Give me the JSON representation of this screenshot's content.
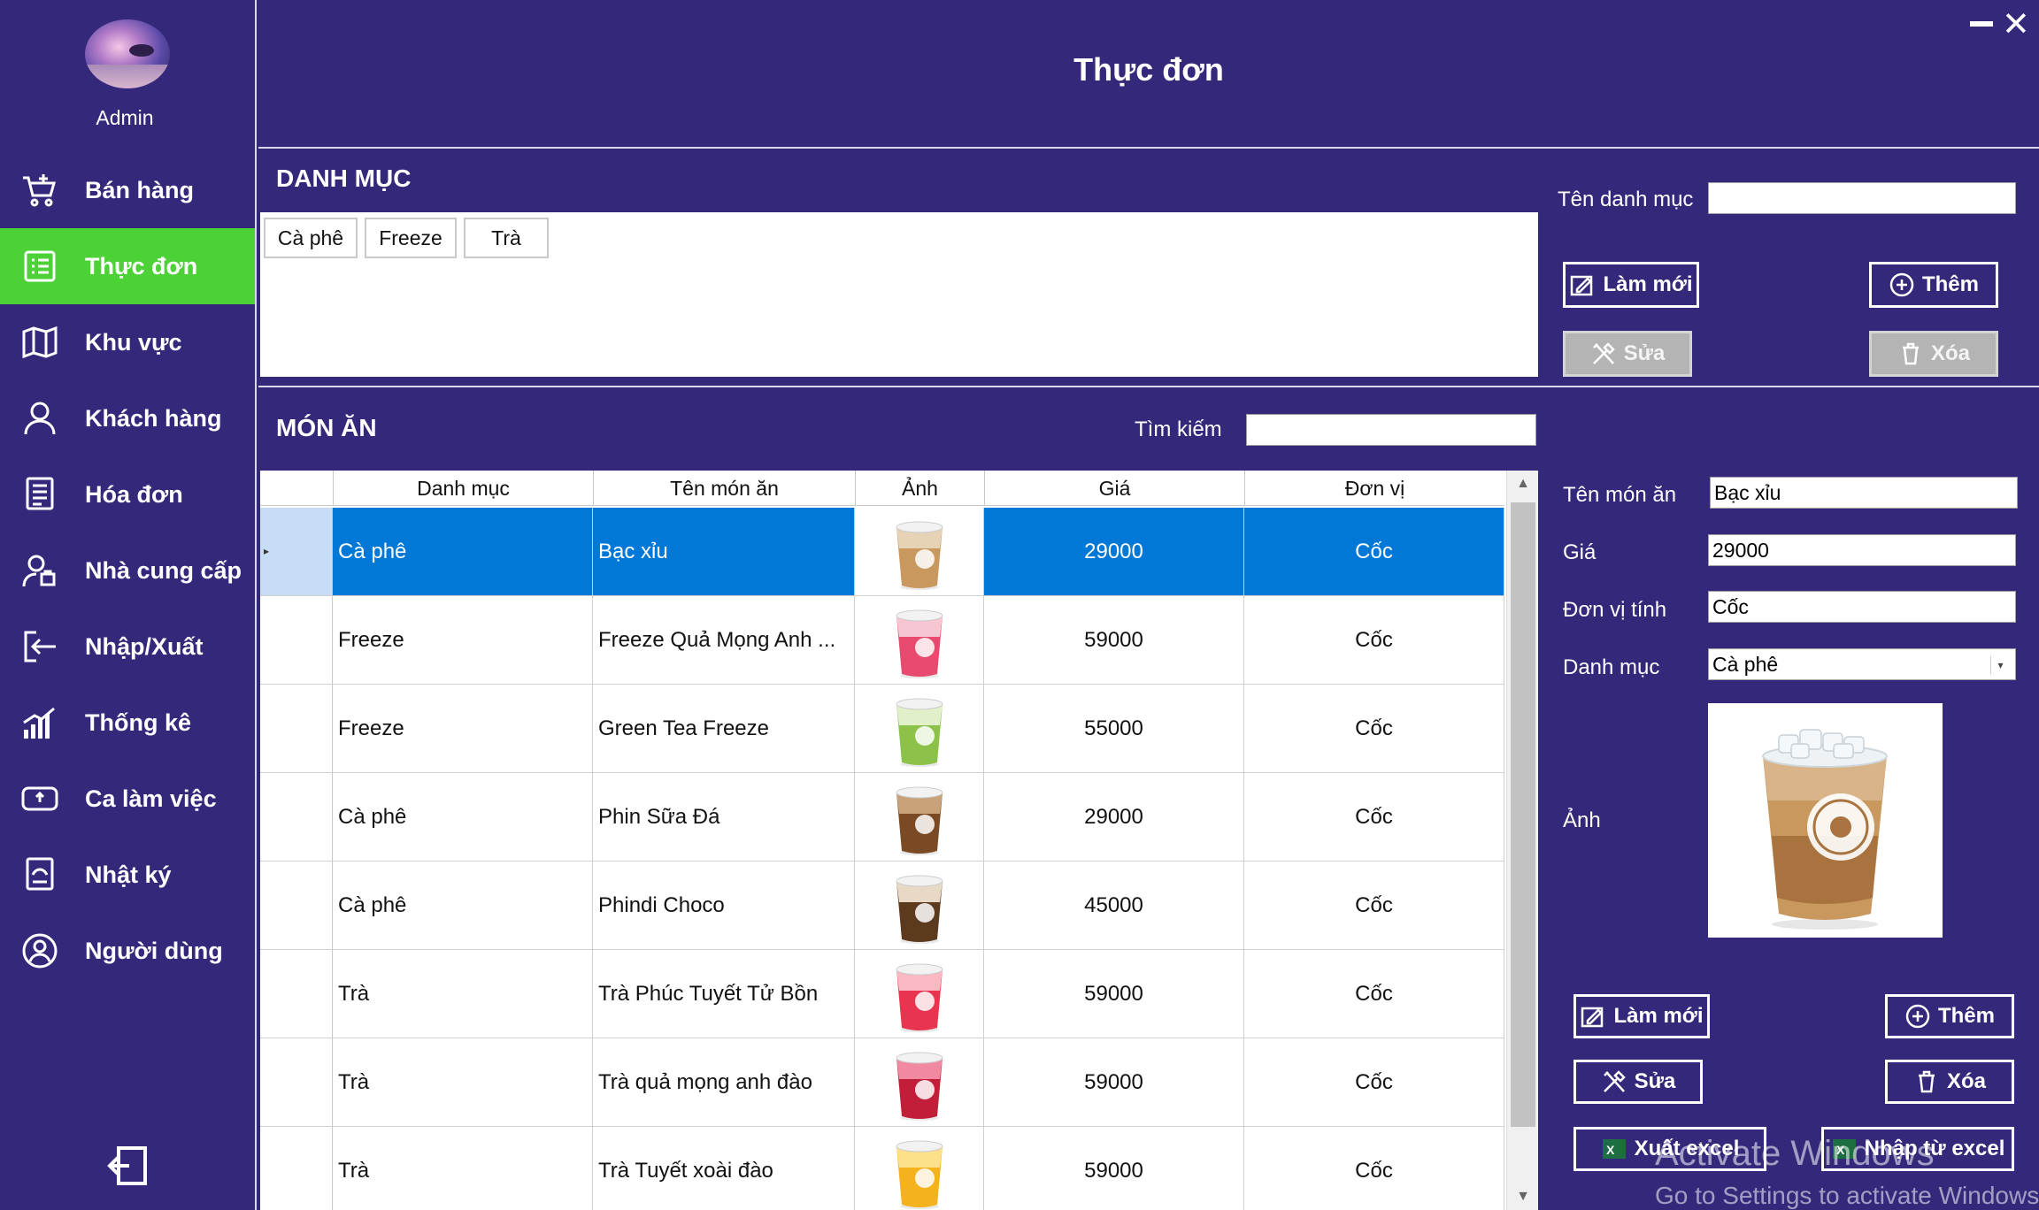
{
  "user": {
    "name": "Admin"
  },
  "window": {
    "title": "Thực đơn"
  },
  "sidebar": {
    "items": [
      {
        "label": "Bán hàng",
        "icon": "cart-icon"
      },
      {
        "label": "Thực đơn",
        "icon": "menu-list-icon",
        "active": true
      },
      {
        "label": "Khu vực",
        "icon": "map-icon"
      },
      {
        "label": "Khách hàng",
        "icon": "person-icon"
      },
      {
        "label": "Hóa đơn",
        "icon": "invoice-icon"
      },
      {
        "label": "Nhà cung cấp",
        "icon": "supplier-icon"
      },
      {
        "label": "Nhập/Xuất",
        "icon": "import-export-icon"
      },
      {
        "label": "Thống kê",
        "icon": "chart-icon"
      },
      {
        "label": "Ca làm việc",
        "icon": "shift-icon"
      },
      {
        "label": "Nhật ký",
        "icon": "log-icon"
      },
      {
        "label": "Người dùng",
        "icon": "user-circle-icon"
      }
    ]
  },
  "category": {
    "section_title": "DANH MỤC",
    "chips": [
      "Cà phê",
      "Freeze",
      "Trà"
    ],
    "name_label": "Tên danh mục",
    "name_value": "",
    "buttons": {
      "refresh": "Làm mới",
      "add": "Thêm",
      "edit": "Sửa",
      "delete": "Xóa"
    }
  },
  "dishes": {
    "section_title": "MÓN ĂN",
    "search_label": "Tìm kiếm",
    "search_value": "",
    "columns": [
      "Danh mục",
      "Tên món ăn",
      "Ảnh",
      "Giá",
      "Đơn vị"
    ],
    "rows": [
      {
        "category": "Cà phê",
        "name": "Bạc xỉu",
        "price": "29000",
        "unit": "Cốc",
        "cup": "latte"
      },
      {
        "category": "Freeze",
        "name": "Freeze Quả Mọng Anh ...",
        "price": "59000",
        "unit": "Cốc",
        "cup": "berry"
      },
      {
        "category": "Freeze",
        "name": "Green Tea Freeze",
        "price": "55000",
        "unit": "Cốc",
        "cup": "green"
      },
      {
        "category": "Cà phê",
        "name": "Phin Sữa Đá",
        "price": "29000",
        "unit": "Cốc",
        "cup": "coffee"
      },
      {
        "category": "Cà phê",
        "name": "Phindi Choco",
        "price": "45000",
        "unit": "Cốc",
        "cup": "choco"
      },
      {
        "category": "Trà",
        "name": "Trà Phúc Tuyết Tử Bồn",
        "price": "59000",
        "unit": "Cốc",
        "cup": "red"
      },
      {
        "category": "Trà",
        "name": "Trà quả mọng anh đào",
        "price": "59000",
        "unit": "Cốc",
        "cup": "cherry"
      },
      {
        "category": "Trà",
        "name": "Trà Tuyết xoài đào",
        "price": "59000",
        "unit": "Cốc",
        "cup": "mango"
      }
    ]
  },
  "detail": {
    "name_label": "Tên món ăn",
    "name_value": "Bạc xỉu",
    "price_label": "Giá",
    "price_value": "29000",
    "unit_label": "Đơn vị tính",
    "unit_value": "Cốc",
    "category_label": "Danh mục",
    "category_value": "Cà phê",
    "image_label": "Ảnh",
    "buttons": {
      "refresh": "Làm mới",
      "add": "Thêm",
      "edit": "Sửa",
      "delete": "Xóa",
      "export": "Xuất excel",
      "import": "Nhập từ excel"
    }
  },
  "watermark": {
    "line1": "Activate Windows",
    "line2": "Go to Settings to activate Windows."
  },
  "colors": {
    "background": "#34287a",
    "active": "#4cd137",
    "selected_row": "#0078d7"
  }
}
